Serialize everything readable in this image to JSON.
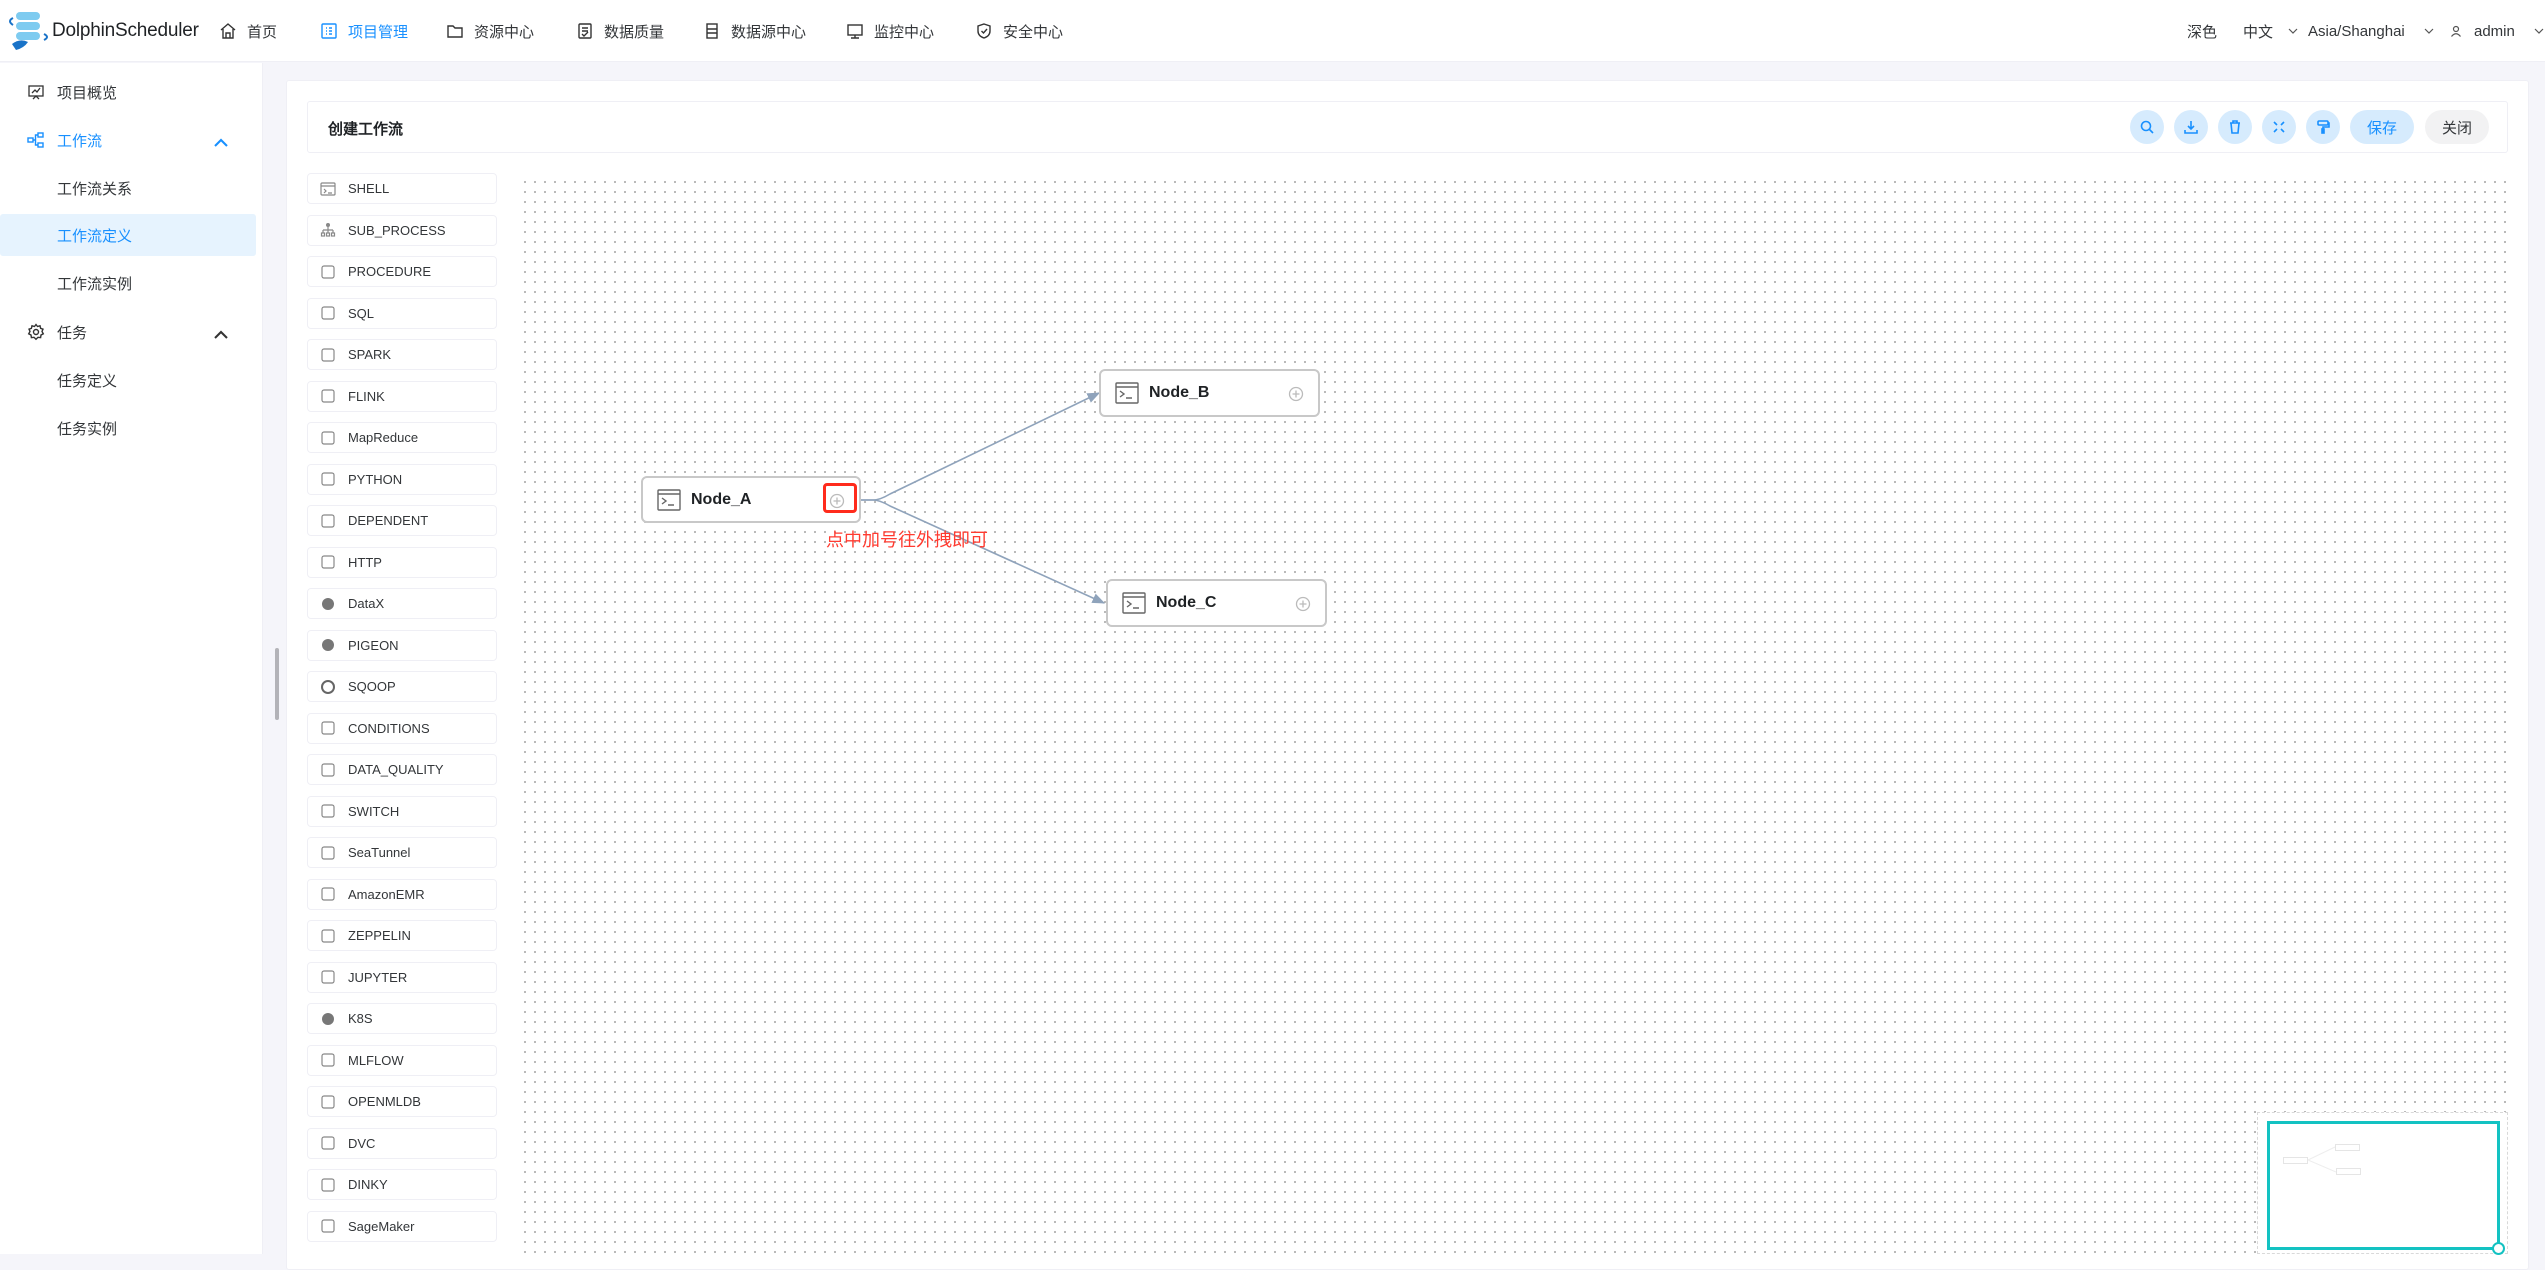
{
  "header": {
    "brand": "DolphinScheduler",
    "nav": [
      {
        "label": "首页",
        "icon": "home-icon"
      },
      {
        "label": "项目管理",
        "icon": "project-icon",
        "active": true
      },
      {
        "label": "资源中心",
        "icon": "folder-icon"
      },
      {
        "label": "数据质量",
        "icon": "data-quality-icon"
      },
      {
        "label": "数据源中心",
        "icon": "datasource-icon"
      },
      {
        "label": "监控中心",
        "icon": "monitor-icon"
      },
      {
        "label": "安全中心",
        "icon": "shield-icon"
      }
    ],
    "theme_label": "深色",
    "language": "中文",
    "timezone": "Asia/Shanghai",
    "user": "admin"
  },
  "sidebar": {
    "items": [
      {
        "label": "项目概览",
        "type": "group",
        "icon": "overview-icon"
      },
      {
        "label": "工作流",
        "type": "group",
        "icon": "workflow-icon",
        "expanded": true
      },
      {
        "label": "工作流关系",
        "type": "sub"
      },
      {
        "label": "工作流定义",
        "type": "sub",
        "selected": true
      },
      {
        "label": "工作流实例",
        "type": "sub"
      },
      {
        "label": "任务",
        "type": "group",
        "icon": "gear-icon",
        "expanded": true
      },
      {
        "label": "任务定义",
        "type": "sub"
      },
      {
        "label": "任务实例",
        "type": "sub"
      }
    ]
  },
  "toolbar": {
    "title": "创建工作流",
    "icon_buttons": [
      "search-icon",
      "download-icon",
      "delete-icon",
      "fullscreen-icon",
      "format-icon"
    ],
    "save_label": "保存",
    "close_label": "关闭"
  },
  "task_types": [
    "SHELL",
    "SUB_PROCESS",
    "PROCEDURE",
    "SQL",
    "SPARK",
    "FLINK",
    "MapReduce",
    "PYTHON",
    "DEPENDENT",
    "HTTP",
    "DataX",
    "PIGEON",
    "SQOOP",
    "CONDITIONS",
    "DATA_QUALITY",
    "SWITCH",
    "SeaTunnel",
    "AmazonEMR",
    "ZEPPELIN",
    "JUPYTER",
    "K8S",
    "MLFLOW",
    "OPENMLDB",
    "DVC",
    "DINKY",
    "SageMaker"
  ],
  "dag": {
    "nodes": [
      {
        "id": "A",
        "label": "Node_A",
        "type": "SHELL"
      },
      {
        "id": "B",
        "label": "Node_B",
        "type": "SHELL"
      },
      {
        "id": "C",
        "label": "Node_C",
        "type": "SHELL"
      }
    ],
    "edges": [
      {
        "from": "A",
        "to": "B"
      },
      {
        "from": "A",
        "to": "C"
      }
    ],
    "annotation": "点中加号往外拽即可"
  },
  "colors": {
    "accent": "#1890ff",
    "annotation": "#ff3b30",
    "edge": "#8fa3bb",
    "minimap_view": "#13c2c2"
  }
}
